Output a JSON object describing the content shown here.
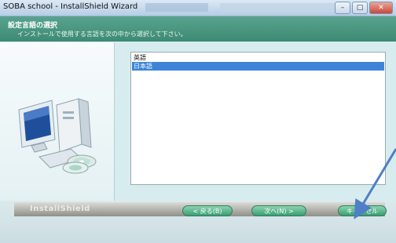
{
  "window": {
    "title": "SOBA school - InstallShield Wizard",
    "controls": {
      "minimize": "–",
      "maximize": "□",
      "close": "✕"
    }
  },
  "header": {
    "title": "設定言語の選択",
    "subtitle": "インストールで使用する言語を次の中から選択して下さい。"
  },
  "language_list": {
    "options": [
      "英語",
      "日本語"
    ],
    "selected": "日本語"
  },
  "footer": {
    "brand": "InstallShield",
    "back_label": "< 戻る(B)",
    "next_label": "次へ(N) >",
    "cancel_label": "キャンセル"
  },
  "colors": {
    "header_green": "#4b977f",
    "button_green": "#3a9c72",
    "selection_blue": "#3d84d8",
    "annotation_arrow": "#4f7fc6"
  },
  "icons": [
    "computer-icon",
    "cd-disc-icon"
  ]
}
